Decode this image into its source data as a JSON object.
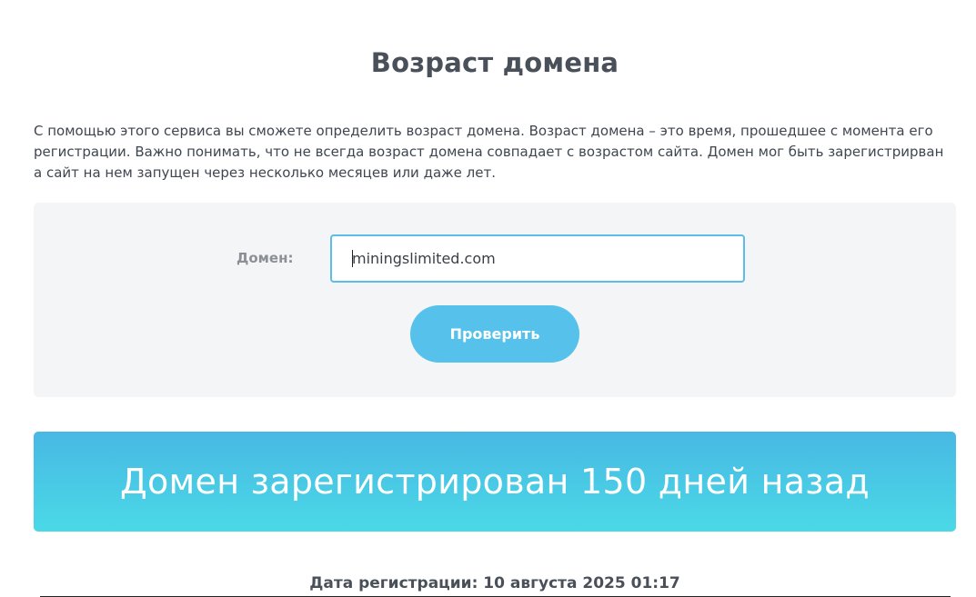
{
  "page": {
    "title": "Возраст домена",
    "description": "С помощью этого сервиса вы сможете определить возраст домена. Возраст домена – это время, прошедшее с момента его регистрации. Важно понимать, что не всегда возраст домена совпадает с возрастом сайта. Домен мог быть зарегистрирван а сайт на нем запущен через несколько месяцев или даже лет."
  },
  "form": {
    "domain_label": "Домен:",
    "domain_value": "miningslimited.com",
    "submit_label": "Проверить"
  },
  "result": {
    "summary": "Домен зарегистрирован 150 дней назад",
    "registration_date": "Дата регистрации: 10 августа 2025 01:17"
  },
  "colors": {
    "accent": "#56c1ea",
    "banner_top": "#48b8e4",
    "banner_bottom": "#4ad9e6",
    "form_bg": "#f3f5f6"
  }
}
